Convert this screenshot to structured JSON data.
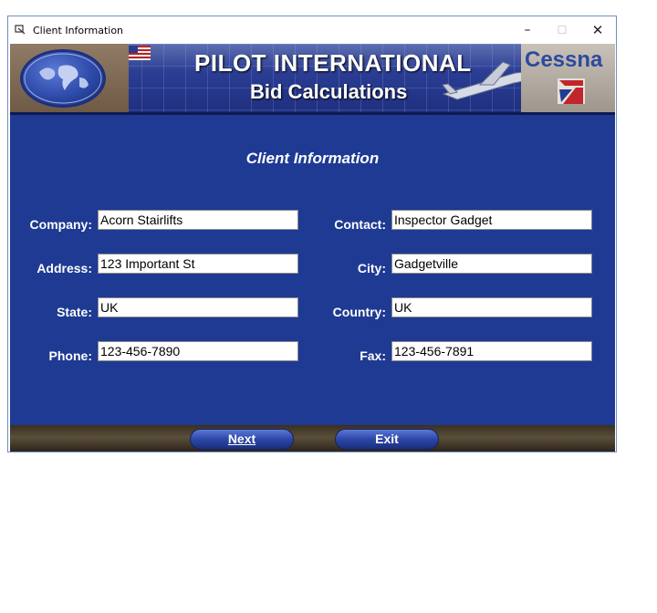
{
  "window": {
    "title": "Client Information"
  },
  "banner": {
    "title": "PILOT INTERNATIONAL",
    "subtitle": "Bid Calculations",
    "brand": "Cessna"
  },
  "form": {
    "heading": "Client Information",
    "company": {
      "label": "Company:",
      "value": "Acorn Stairlifts"
    },
    "address": {
      "label": "Address:",
      "value": "123 Important St"
    },
    "state": {
      "label": "State:",
      "value": "UK"
    },
    "phone": {
      "label": "Phone:",
      "value": "123-456-7890"
    },
    "contact": {
      "label": "Contact:",
      "value": "Inspector Gadget"
    },
    "city": {
      "label": "City:",
      "value": "Gadgetville"
    },
    "country": {
      "label": "Country:",
      "value": "UK"
    },
    "fax": {
      "label": "Fax:",
      "value": "123-456-7891"
    }
  },
  "footer": {
    "next_label": "Next",
    "exit_label": "Exit"
  },
  "colors": {
    "panel": "#1f3a93",
    "accent": "#2d47a8"
  }
}
